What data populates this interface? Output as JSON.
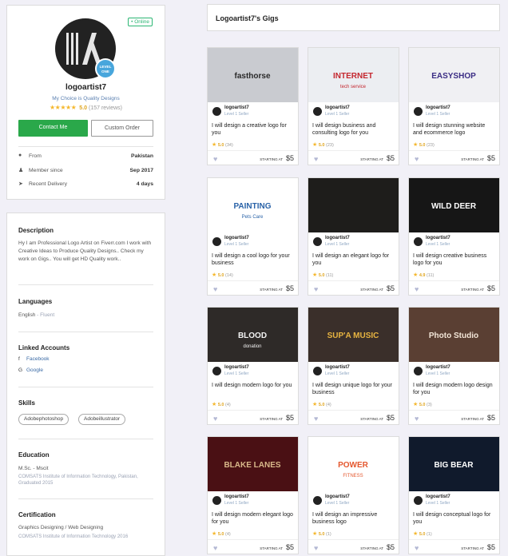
{
  "profile": {
    "online": "• Online",
    "level_badge": "LEVEL ONE",
    "username": "logoartist7",
    "tagline": "My Choice is Quality Designs",
    "stars": "★★★★★",
    "rating": "5.0",
    "reviews": "(157 reviews)",
    "contact_label": "Contact Me",
    "custom_order_label": "Custom Order",
    "info": [
      {
        "icon": "location-icon",
        "label": "From",
        "value": "Pakistan"
      },
      {
        "icon": "user-icon",
        "label": "Member since",
        "value": "Sep 2017"
      },
      {
        "icon": "delivery-icon",
        "label": "Recent Delivery",
        "value": "4 days"
      }
    ]
  },
  "about": {
    "description_heading": "Description",
    "description": "Hy I am Professional Logo Artist on Fiverr.com I work with Creative Ideas to Produce Quality Designs.. Check my work on Gigs.. You will get HD Quality work..",
    "languages_heading": "Languages",
    "language": "English",
    "language_level": " - Fluent",
    "linked_heading": "Linked Accounts",
    "linked": [
      "Facebook",
      "Google"
    ],
    "skills_heading": "Skills",
    "skills": [
      "Adobephotoshop",
      "Adobeillustrator"
    ],
    "education_heading": "Education",
    "education_degree": "M.Sc. - Mscit",
    "education_detail": "COMSATS Institute of Information Technology, Pakistan, Graduated 2015",
    "certification_heading": "Certification",
    "certification_name": "Graphics Designing / Web Designing",
    "certification_detail": "COMSATS Institute of Information Technology 2016"
  },
  "gigs_header": "Logoartist7's Gigs",
  "gig_common": {
    "seller": "logoartist7",
    "level": "Level 1 Seller",
    "star": "★",
    "starting_at": "STARTING AT",
    "price": "$5",
    "heart": "♥"
  },
  "gigs": [
    {
      "title": "I will design a creative logo for you",
      "rating": "5.0",
      "count": "(34)",
      "img_text": "fasthorse",
      "img_sub": "",
      "bg": "#c9cbd0",
      "fg": "#2a2a2a"
    },
    {
      "title": "I will design business and consulting logo for you",
      "rating": "5.0",
      "count": "(23)",
      "img_text": "INTERNET",
      "img_sub": "tech service",
      "bg": "#eceef2",
      "fg": "#c4262e"
    },
    {
      "title": "I will design stunning website and ecommerce logo",
      "rating": "5.0",
      "count": "(23)",
      "img_text": "EASYSHOP",
      "img_sub": "",
      "bg": "#f0f0f3",
      "fg": "#3b2d84"
    },
    {
      "title": "I will design a cool logo for your business",
      "rating": "5.0",
      "count": "(14)",
      "img_text": "PAINTING",
      "img_sub": "Pets Care",
      "bg": "#ffffff",
      "fg": "#2a63a8"
    },
    {
      "title": "I will design an elegant logo for you",
      "rating": "5.0",
      "count": "(11)",
      "img_text": "",
      "img_sub": "",
      "bg": "#1e1d1b",
      "fg": "#c7a96b"
    },
    {
      "title": "I will design creative business logo for you",
      "rating": "4.9",
      "count": "(11)",
      "img_text": "WILD DEER",
      "img_sub": "",
      "bg": "#161616",
      "fg": "#ffffff"
    },
    {
      "title": "I will design modern logo for you",
      "rating": "5.0",
      "count": "(4)",
      "img_text": "BLOOD",
      "img_sub": "donation",
      "bg": "#2e2a28",
      "fg": "#f2f2f2"
    },
    {
      "title": "I will design unique logo for your business",
      "rating": "5.0",
      "count": "(4)",
      "img_text": "SUP'A MUSIC",
      "img_sub": "",
      "bg": "#3a2f2a",
      "fg": "#e7b441"
    },
    {
      "title": "I will design modern logo design for you",
      "rating": "5.0",
      "count": "(3)",
      "img_text": "Photo Studio",
      "img_sub": "",
      "bg": "#5a3f33",
      "fg": "#f3e6d8"
    },
    {
      "title": "I will design modern elegant logo for you",
      "rating": "5.0",
      "count": "(4)",
      "img_text": "BLAKE LANES",
      "img_sub": "",
      "bg": "#4a1014",
      "fg": "#d8b88a"
    },
    {
      "title": "I will design an impressive business logo",
      "rating": "5.0",
      "count": "(1)",
      "img_text": "POWER",
      "img_sub": "FITNESS",
      "bg": "#ffffff",
      "fg": "#e4572e"
    },
    {
      "title": "I will design conceptual logo for you",
      "rating": "5.0",
      "count": "(1)",
      "img_text": "BIG BEAR",
      "img_sub": "",
      "bg": "#101a2c",
      "fg": "#ffffff"
    }
  ]
}
